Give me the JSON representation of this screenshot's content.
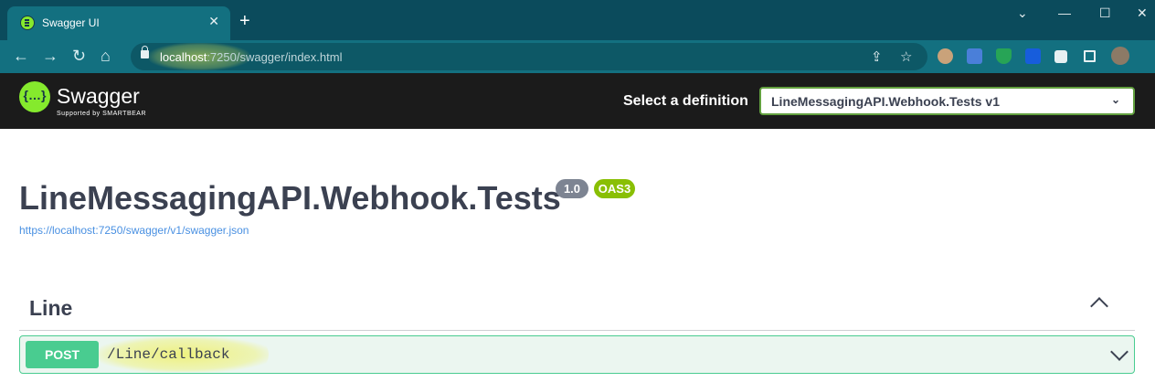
{
  "browser": {
    "tab_title": "Swagger UI",
    "tab_close": "✕",
    "new_tab": "+",
    "controls": {
      "minimize": "—",
      "maximize": "☐",
      "close": "✕",
      "tab_search": "⌄"
    },
    "url": {
      "host": "localhost",
      "rest": ":7250/swagger/index.html"
    },
    "nav": {
      "back": "←",
      "forward": "→",
      "reload": "↻",
      "home": "⌂"
    },
    "omni_icons": {
      "share": "⇪",
      "bookmark": "☆"
    }
  },
  "swagger": {
    "logo_text": "Swagger",
    "logo_mark": "{…}",
    "logo_sub": "Supported by SMARTBEAR",
    "select_label": "Select a definition",
    "select_value": "LineMessagingAPI.Webhook.Tests v1",
    "select_chevron": "⌄"
  },
  "info": {
    "title": "LineMessagingAPI.Webhook.Tests",
    "version": "1.0",
    "oas": "OAS3",
    "spec_url": "https://localhost:7250/swagger/v1/swagger.json"
  },
  "tag": {
    "name": "Line",
    "operations": [
      {
        "method": "POST",
        "path": "/Line/callback"
      }
    ]
  },
  "colors": {
    "chrome_dark": "#0b4b5c",
    "chrome_toolbar": "#137080",
    "swagger_green": "#85ea2d",
    "post_green": "#49cc90",
    "text_dark": "#3b4151",
    "link_blue": "#4990e2"
  }
}
